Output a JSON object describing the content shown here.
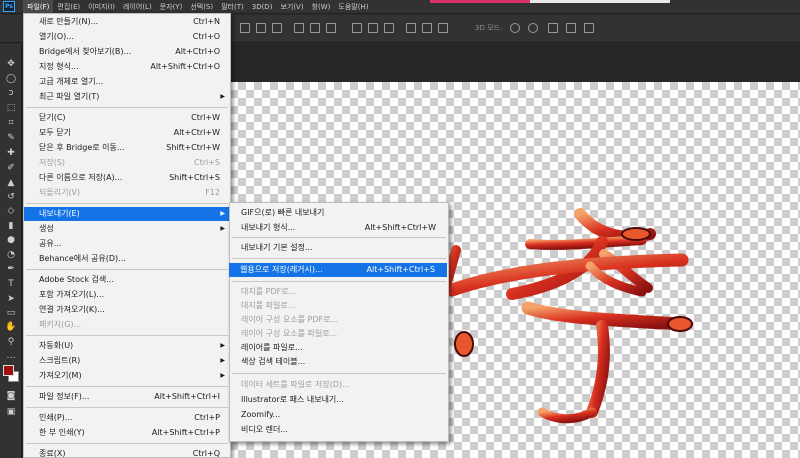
{
  "menubar": {
    "logo": "Ps",
    "items": [
      "파일(F)",
      "편집(E)",
      "이미지(I)",
      "레이어(L)",
      "문자(Y)",
      "선택(S)",
      "필터(T)",
      "3D(D)",
      "보기(V)",
      "창(W)",
      "도움말(H)"
    ]
  },
  "options": {
    "mode_3d": "3D 모드:"
  },
  "file_menu": {
    "items": [
      {
        "label": "새로 만들기(N)...",
        "shortcut": "Ctrl+N"
      },
      {
        "label": "열기(O)...",
        "shortcut": "Ctrl+O"
      },
      {
        "label": "Bridge에서 찾아보기(B)...",
        "shortcut": "Alt+Ctrl+O"
      },
      {
        "label": "지정 형식...",
        "shortcut": "Alt+Shift+Ctrl+O"
      },
      {
        "label": "고급 개체로 열기...",
        "shortcut": ""
      },
      {
        "label": "최근 파일 열기(T)",
        "shortcut": ""
      },
      {
        "label": "닫기(C)",
        "shortcut": "Ctrl+W"
      },
      {
        "label": "모두 닫기",
        "shortcut": "Alt+Ctrl+W"
      },
      {
        "label": "닫은 후 Bridge로 이동...",
        "shortcut": "Shift+Ctrl+W"
      },
      {
        "label": "저장(S)",
        "shortcut": "Ctrl+S"
      },
      {
        "label": "다른 이름으로 저장(A)...",
        "shortcut": "Shift+Ctrl+S"
      },
      {
        "label": "되돌리기(V)",
        "shortcut": "F12"
      },
      {
        "label": "내보내기(E)",
        "shortcut": ""
      },
      {
        "label": "생성",
        "shortcut": ""
      },
      {
        "label": "공유...",
        "shortcut": ""
      },
      {
        "label": "Behance에서 공유(D)...",
        "shortcut": ""
      },
      {
        "label": "Adobe Stock 검색...",
        "shortcut": ""
      },
      {
        "label": "포함 가져오기(L)...",
        "shortcut": ""
      },
      {
        "label": "연결 가져오기(K)...",
        "shortcut": ""
      },
      {
        "label": "패키지(G)...",
        "shortcut": ""
      },
      {
        "label": "자동화(U)",
        "shortcut": ""
      },
      {
        "label": "스크립트(R)",
        "shortcut": ""
      },
      {
        "label": "가져오기(M)",
        "shortcut": ""
      },
      {
        "label": "파일 정보(F)...",
        "shortcut": "Alt+Shift+Ctrl+I"
      },
      {
        "label": "인쇄(P)...",
        "shortcut": "Ctrl+P"
      },
      {
        "label": "한 부 인쇄(Y)",
        "shortcut": "Alt+Shift+Ctrl+P"
      },
      {
        "label": "종료(X)",
        "shortcut": "Ctrl+Q"
      }
    ]
  },
  "export_menu": {
    "items": [
      {
        "label": "GIF으(로) 빠른 내보내기",
        "shortcut": ""
      },
      {
        "label": "내보내기 형식...",
        "shortcut": "Alt+Shift+Ctrl+W"
      },
      {
        "label": "내보내기 기본 설정...",
        "shortcut": ""
      },
      {
        "label": "웹용으로 저장(레거시)...",
        "shortcut": "Alt+Shift+Ctrl+S"
      },
      {
        "label": "대지를 PDF로...",
        "shortcut": ""
      },
      {
        "label": "대지를 파일로...",
        "shortcut": ""
      },
      {
        "label": "레이어 구성 요소를 PDF로...",
        "shortcut": ""
      },
      {
        "label": "레이어 구성 요소를 파일로...",
        "shortcut": ""
      },
      {
        "label": "레이어를 파일로...",
        "shortcut": ""
      },
      {
        "label": "색상 검색 테이블...",
        "shortcut": ""
      },
      {
        "label": "데이터 세트를 파일로 저장(D)...",
        "shortcut": ""
      },
      {
        "label": "Illustrator로 패스 내보내기...",
        "shortcut": ""
      },
      {
        "label": "Zoomify...",
        "shortcut": ""
      },
      {
        "label": "비디오 렌더...",
        "shortcut": ""
      }
    ]
  },
  "colors": {
    "foreground": "#9e1010",
    "background": "#ffffff",
    "highlight": "#1473e6"
  }
}
